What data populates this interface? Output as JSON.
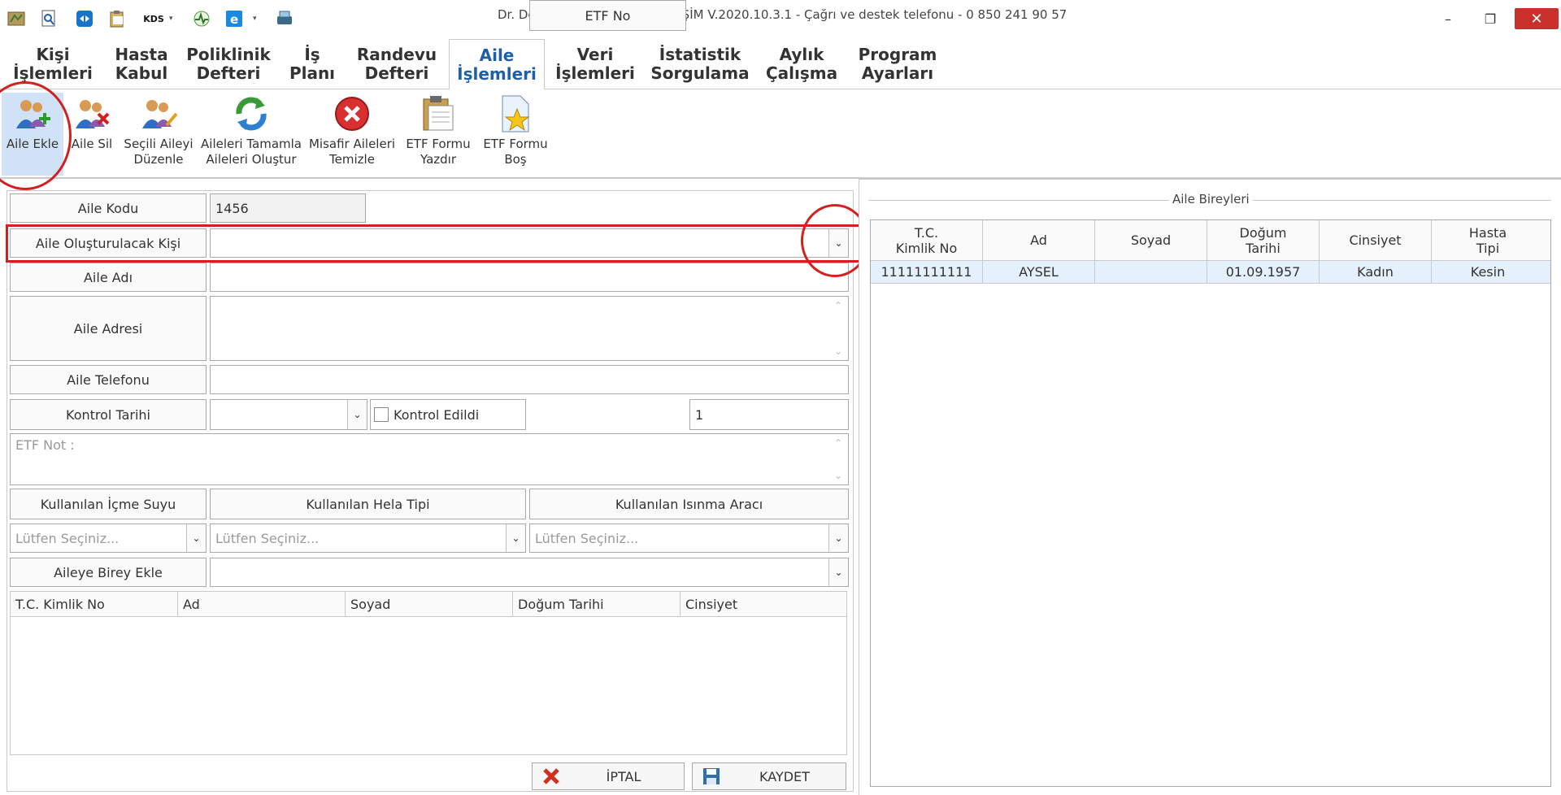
{
  "window": {
    "title": "Dr. Demo DOKTOR - HIZIR BİLİŞİM V.2020.10.3.1 - Çağrı ve destek telefonu - 0 850 241 90 57",
    "minimize": "–",
    "restore": "❐",
    "close": "✕"
  },
  "quick_access": {
    "kds_label": "KDS",
    "dropdown_glyph": "▾"
  },
  "tabs": [
    {
      "line1": "Kişi",
      "line2": "İşlemleri"
    },
    {
      "line1": "Hasta",
      "line2": "Kabul"
    },
    {
      "line1": "Poliklinik",
      "line2": "Defteri"
    },
    {
      "line1": "İş",
      "line2": "Planı"
    },
    {
      "line1": "Randevu",
      "line2": "Defteri"
    },
    {
      "line1": "Aile",
      "line2": "İşlemleri"
    },
    {
      "line1": "Veri",
      "line2": "İşlemleri"
    },
    {
      "line1": "İstatistik",
      "line2": "Sorgulama"
    },
    {
      "line1": "Aylık",
      "line2": "Çalışma"
    },
    {
      "line1": "Program",
      "line2": "Ayarları"
    }
  ],
  "ribbon": {
    "aile_ekle": "Aile Ekle",
    "aile_sil": "Aile Sil",
    "secili_line1": "Seçili Aileyi",
    "secili_line2": "Düzenle",
    "tamamla_line1": "Aileleri Tamamla",
    "tamamla_line2": "Aileleri Oluştur",
    "misafir_line1": "Misafir Aileleri",
    "misafir_line2": "Temizle",
    "etf_yazdir_line1": "ETF Formu",
    "etf_yazdir_line2": "Yazdır",
    "etf_bos_line1": "ETF Formu",
    "etf_bos_line2": "Boş"
  },
  "form": {
    "aile_kodu_label": "Aile Kodu",
    "aile_kodu_value": "1456",
    "olusturulacak_label": "Aile Oluşturulacak Kişi",
    "olusturulacak_value": "",
    "aile_adi_label": "Aile Adı",
    "aile_adi_value": "",
    "aile_adresi_label": "Aile Adresi",
    "aile_adresi_value": "",
    "aile_telefonu_label": "Aile Telefonu",
    "aile_telefonu_value": "",
    "kontrol_tarihi_label": "Kontrol Tarihi",
    "kontrol_tarihi_value": "",
    "kontrol_edildi_label": "Kontrol Edildi",
    "etf_no_label": "ETF No",
    "etf_no_value": "1",
    "etf_not_label": "ETF Not :",
    "icme_suyu_label": "Kullanılan İçme Suyu",
    "hela_tipi_label": "Kullanılan Hela Tipi",
    "isinma_araci_label": "Kullanılan Isınma Aracı",
    "select_placeholder": "Lütfen Seçiniz...",
    "birey_ekle_label": "Aileye Birey Ekle",
    "birey_ekle_value": "",
    "dropdown_glyph": "⌄",
    "scroll_up": "⌃",
    "scroll_down": "⌄"
  },
  "member_grid": {
    "columns": [
      "T.C. Kimlik No",
      "Ad",
      "Soyad",
      "Doğum Tarihi",
      "Cinsiyet"
    ]
  },
  "buttons": {
    "iptal": "İPTAL",
    "kaydet": "KAYDET"
  },
  "right_panel": {
    "title": "Aile Bireyleri",
    "columns": [
      {
        "line1": "T.C.",
        "line2": "Kimlik No"
      },
      {
        "line1": "Ad",
        "line2": ""
      },
      {
        "line1": "Soyad",
        "line2": ""
      },
      {
        "line1": "Doğum",
        "line2": "Tarihi"
      },
      {
        "line1": "Cinsiyet",
        "line2": ""
      },
      {
        "line1": "Hasta",
        "line2": "Tipi"
      }
    ],
    "rows": [
      {
        "tc": "11111111111",
        "ad": "AYSEL",
        "soyad": "",
        "dogum": "01.09.1957",
        "cinsiyet": "Kadın",
        "tip": "Kesin"
      }
    ]
  },
  "colors": {
    "accent": "#1f5fa8",
    "annotation": "#d22020",
    "selected_row": "#e4f0fb",
    "selected_button": "#cfe2f6"
  }
}
